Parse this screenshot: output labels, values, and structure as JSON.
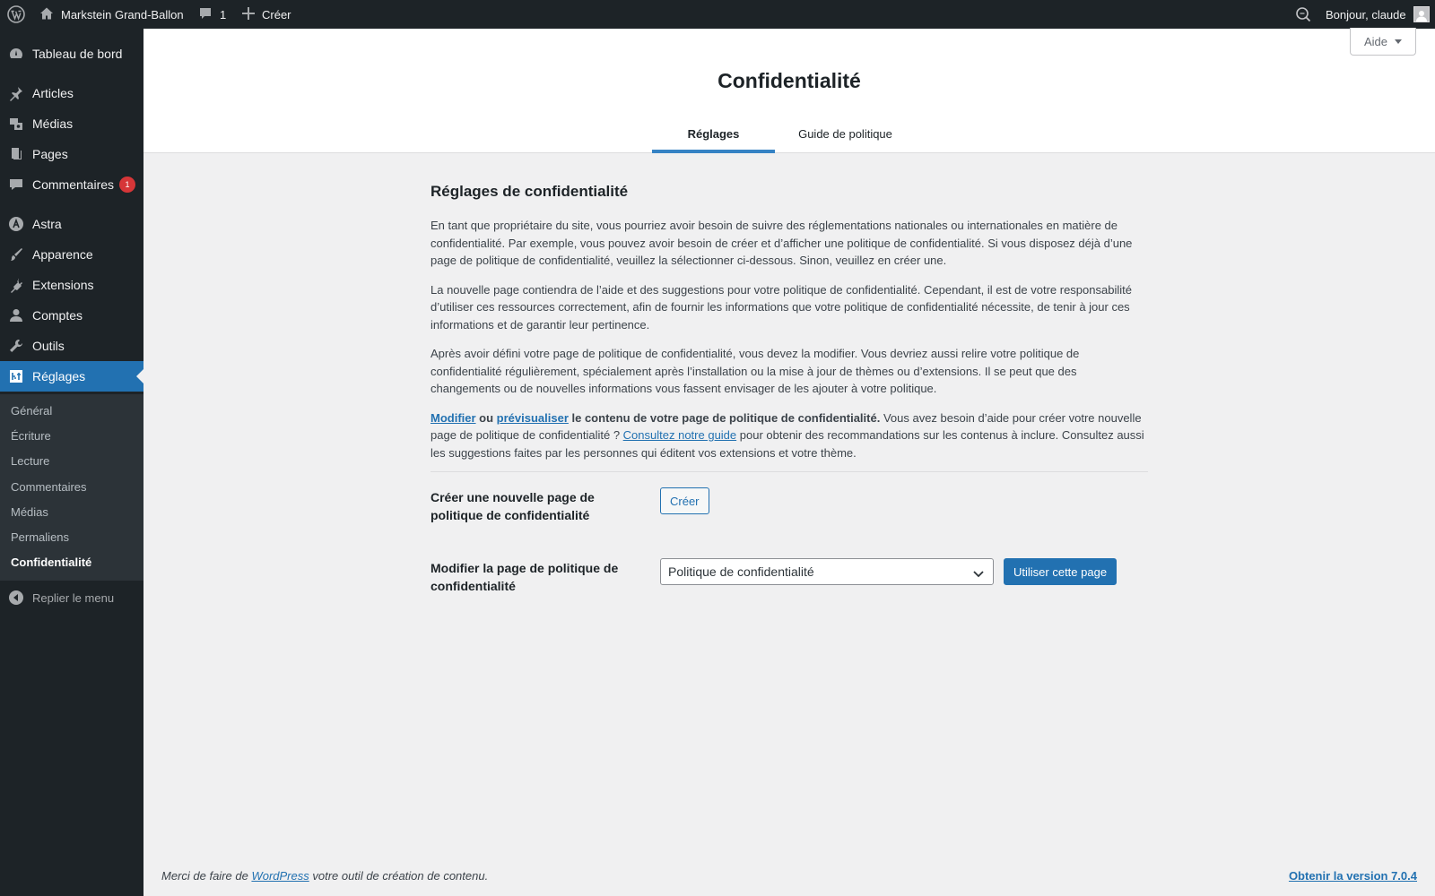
{
  "adminbar": {
    "site_name": "Markstein Grand-Ballon",
    "comments_count": "1",
    "new_label": "Créer",
    "greeting": "Bonjour, claude"
  },
  "sidebar": {
    "items": [
      {
        "label": "Tableau de bord",
        "icon": "dashboard-icon"
      },
      {
        "label": "Articles",
        "icon": "pin-icon"
      },
      {
        "label": "Médias",
        "icon": "media-icon"
      },
      {
        "label": "Pages",
        "icon": "pages-icon"
      },
      {
        "label": "Commentaires",
        "icon": "comments-icon",
        "badge": "1"
      },
      {
        "label": "Astra",
        "icon": "astra-icon"
      },
      {
        "label": "Apparence",
        "icon": "brush-icon"
      },
      {
        "label": "Extensions",
        "icon": "plugin-icon"
      },
      {
        "label": "Comptes",
        "icon": "user-icon"
      },
      {
        "label": "Outils",
        "icon": "wrench-icon"
      },
      {
        "label": "Réglages",
        "icon": "settings-icon"
      }
    ],
    "submenu": [
      "Général",
      "Écriture",
      "Lecture",
      "Commentaires",
      "Médias",
      "Permaliens",
      "Confidentialité"
    ],
    "collapse_label": "Replier le menu"
  },
  "header": {
    "title": "Confidentialité",
    "help_label": "Aide",
    "tabs": [
      {
        "label": "Réglages",
        "active": true
      },
      {
        "label": "Guide de politique",
        "active": false
      }
    ]
  },
  "content": {
    "heading": "Réglages de confidentialité",
    "p1": "En tant que propriétaire du site, vous pourriez avoir besoin de suivre des réglementations nationales ou internationales en matière de confidentialité. Par exemple, vous pouvez avoir besoin de créer et d’afficher une politique de confidentialité. Si vous disposez déjà d’une page de politique de confidentialité, veuillez la sélectionner ci-dessous. Sinon, veuillez en créer une.",
    "p2": "La nouvelle page contiendra de l’aide et des suggestions pour votre politique de confidentialité. Cependant, il est de votre responsabilité d’utiliser ces ressources correctement, afin de fournir les informations que votre politique de confidentialité nécessite, de tenir à jour ces informations et de garantir leur pertinence.",
    "p3": "Après avoir défini votre page de politique de confidentialité, vous devez la modifier. Vous devriez aussi relire votre politique de confidentialité régulièrement, spécialement après l’installation ou la mise à jour de thèmes ou d’extensions. Il se peut que des changements ou de nouvelles informations vous fassent envisager de les ajouter à votre politique.",
    "p4": {
      "edit_link": "Modifier",
      "or": " ou ",
      "preview_link": "prévisualiser",
      "bold_rest": " le contenu de votre page de politique de confidentialité.",
      "text1": " Vous avez besoin d’aide pour créer votre nouvelle page de politique de confidentialité ? ",
      "guide_link": "Consultez notre guide",
      "text2": " pour obtenir des recommandations sur les contenus à inclure. Consultez aussi les suggestions faites par les personnes qui éditent vos extensions et votre thème."
    },
    "create_label": "Créer une nouvelle page de politique de confidentialité",
    "create_button": "Créer",
    "change_label": "Modifier la page de politique de confidentialité",
    "select_value": "Politique de confidentialité",
    "use_button": "Utiliser cette page"
  },
  "footer": {
    "thanks_before": "Merci de faire de ",
    "thanks_link": "WordPress",
    "thanks_after": " votre outil de création de contenu.",
    "upgrade": "Obtenir la version 7.0.4"
  },
  "colors": {
    "admin_bg": "#1d2327",
    "accent": "#2271b1",
    "badge": "#d63638"
  }
}
